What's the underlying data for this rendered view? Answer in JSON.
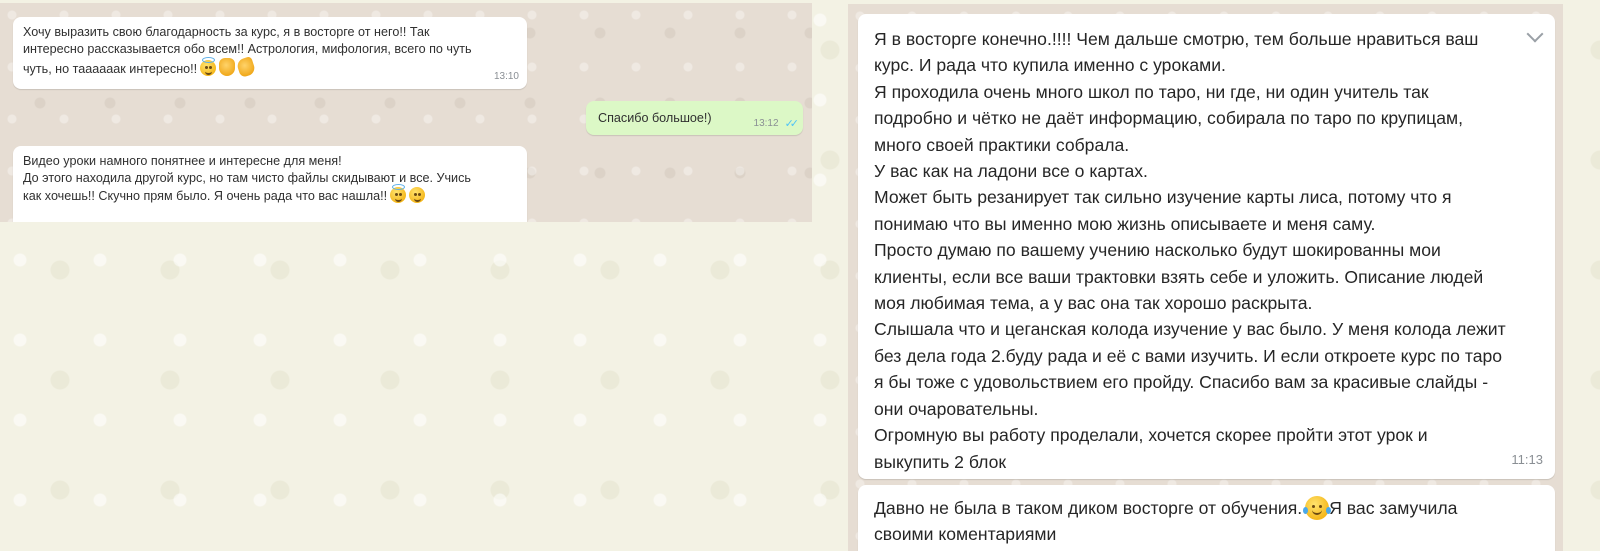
{
  "left_chat": {
    "messages": [
      {
        "direction": "incoming",
        "text": "Хочу выразить свою благодарность за курс, я в восторге от него!! Так\nинтересно рассказывается обо всем!! Астрология, мифология, всего по чуть\nчуть, но таааааак интересно!!",
        "time": "13:10",
        "emojis": [
          "smiling-face-with-halo-icon",
          "thumbs-up-icon",
          "clapping-hands-icon"
        ]
      },
      {
        "direction": "outgoing",
        "text": "Спасибо большое!)",
        "time": "13:12",
        "status": "read-double-check-icon"
      },
      {
        "direction": "incoming",
        "text": "Видео уроки намного понятнее и интересне для меня!\nДо этого находила другой курс, но там чисто файлы скидывают и все. Учись\nкак хочешь!! Скучно прям было. Я очень рада что вас нашла!!",
        "emojis": [
          "smiling-face-with-halo-icon",
          "relieved-face-icon"
        ]
      }
    ]
  },
  "right_chat": {
    "messages": [
      {
        "direction": "incoming",
        "text": "Я в восторге конечно.!!!! Чем дальше смотрю, тем больше нравиться ваш\nкурс. И рада что купила именно с уроками.\nЯ проходила очень много школ по таро, ни где, ни один учитель так\nподробно и чётко не даёт информацию, собирала по таро по крупицам,\nмного своей практики собрала.\nУ вас как на ладони все о картах.\nМожет быть резанирует  так сильно изучение карты лиса, потому что я\nпонимаю что вы именно мою жизнь описываете и меня саму.\nПросто думаю по вашему учению насколько будут шокированны мои\nклиенты, если все ваши  трактовки взять себе и уложить. Описание людей\nмоя любимая тема, а у вас она так хорошо раскрыта.\nСлышала что и цеганская колода изучение у вас было. У меня колода лежит\nбез дела года 2.буду рада и её с вами изучить. И если откроете курс по таро\nя бы тоже с удовольствием его пройду. Спасибо вам за красивые слайды -\nони очаровательны.\nОгромную вы работу проделали, хочется скорее пройти этот урок и\nвыкупить 2 блок",
        "time": "11:13",
        "menu_icon": "chevron-down-icon"
      },
      {
        "direction": "incoming",
        "text_before": "Давно не была в таком диком восторге от обучения.",
        "emoji": "face-with-tears-of-joy-icon",
        "text_after": "Я вас замучила\nсвоими коментариями"
      }
    ]
  }
}
